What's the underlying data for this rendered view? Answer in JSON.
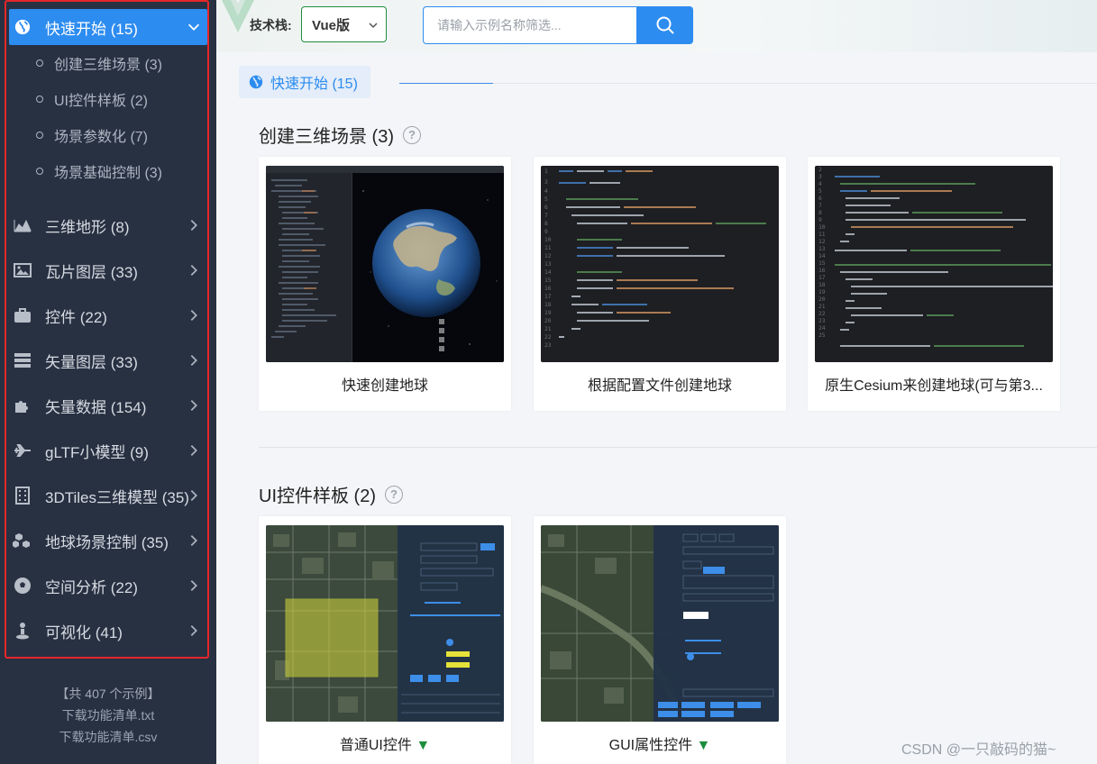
{
  "sidebar": {
    "menu": [
      {
        "label": "快速开始 (15)",
        "icon": "globe-icon",
        "active": true
      },
      {
        "label": "三维地形 (8)",
        "icon": "area-chart-icon"
      },
      {
        "label": "瓦片图层 (33)",
        "icon": "picture-icon"
      },
      {
        "label": "控件 (22)",
        "icon": "briefcase-icon"
      },
      {
        "label": "矢量图层 (33)",
        "icon": "server-icon"
      },
      {
        "label": "矢量数据 (154)",
        "icon": "puzzle-icon"
      },
      {
        "label": "gLTF小模型 (9)",
        "icon": "plane-icon"
      },
      {
        "label": "3DTiles三维模型 (35)",
        "icon": "building-icon"
      },
      {
        "label": "地球场景控制 (35)",
        "icon": "cubes-icon"
      },
      {
        "label": "空间分析 (22)",
        "icon": "soccer-ball-icon"
      },
      {
        "label": "可视化 (41)",
        "icon": "user-pin-icon"
      }
    ],
    "submenu": [
      {
        "label": "创建三维场景 (3)"
      },
      {
        "label": "UI控件样板 (2)"
      },
      {
        "label": "场景参数化 (7)"
      },
      {
        "label": "场景基础控制 (3)"
      }
    ],
    "footer": {
      "total": "【共 407 个示例】",
      "download_txt": "下载功能清单.txt",
      "download_csv": "下载功能清单.csv"
    }
  },
  "topbar": {
    "tech_label": "技术栈:",
    "tech_value": "Vue版",
    "search_placeholder": "请输入示例名称筛选..."
  },
  "tab": {
    "label": "快速开始 (15)"
  },
  "sections": [
    {
      "title": "创建三维场景 (3)",
      "cards": [
        {
          "caption": "快速创建地球"
        },
        {
          "caption": "根据配置文件创建地球"
        },
        {
          "caption": "原生Cesium来创建地球(可与第3..."
        }
      ]
    },
    {
      "title": "UI控件样板 (2)",
      "cards": [
        {
          "caption": "普通UI控件"
        },
        {
          "caption": "GUI属性控件"
        }
      ]
    }
  ],
  "watermark": "CSDN @一只敲码的猫~",
  "colors": {
    "sidebar_bg": "#283142",
    "accent": "#2d8cf0",
    "highlight_border": "#e6262a",
    "vue_green": "#1e8e3e"
  }
}
